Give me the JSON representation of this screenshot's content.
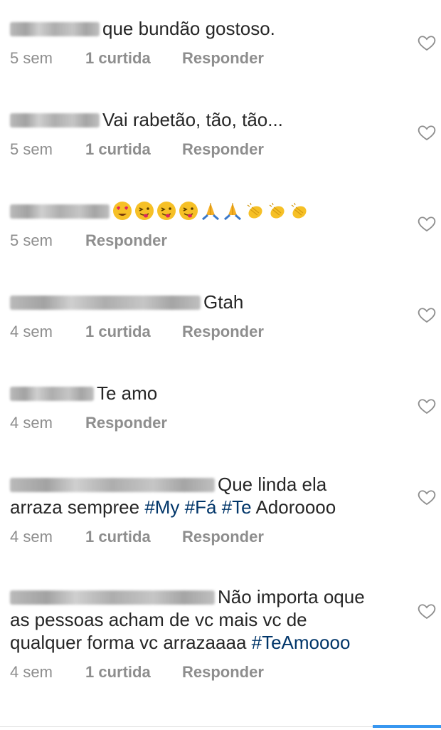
{
  "comments": [
    {
      "text": "que bundão gostoso.",
      "time": "5 sem",
      "likes": "1 curtida",
      "reply": "Responder"
    },
    {
      "text": "Vai rabetão, tão, tão...",
      "time": "5 sem",
      "likes": "1 curtida",
      "reply": "Responder"
    },
    {
      "text": "",
      "emojis": [
        "heart-eyes-emoji",
        "winking-tongue-emoji",
        "winking-tongue-emoji",
        "winking-tongue-emoji",
        "folded-hands-emoji",
        "folded-hands-emoji",
        "clapping-hands-emoji",
        "clapping-hands-emoji",
        "clapping-hands-emoji"
      ],
      "time": "5 sem",
      "reply": "Responder"
    },
    {
      "text": "Gtah",
      "time": "4 sem",
      "likes": "1 curtida",
      "reply": "Responder"
    },
    {
      "text": "Te amo",
      "time": "4 sem",
      "reply": "Responder"
    },
    {
      "text_before": "Que linda ela arraza sempree",
      "tags": [
        "#My",
        "#Fá",
        "#Te"
      ],
      "text_after": "Adoroooo",
      "time": "4 sem",
      "likes": "1 curtida",
      "reply": "Responder"
    },
    {
      "text_before": "Não importa oque as pessoas acham de vc mais vc de qualquer forma vc arrazaaaa",
      "tags": [
        "#TeAmoooo"
      ],
      "time": "4 sem",
      "likes": "1 curtida",
      "reply": "Responder"
    }
  ],
  "icons": {
    "like": "heart-outline-icon"
  },
  "colors": {
    "text": "#262626",
    "meta": "#8e8e8e",
    "hashtag": "#003569",
    "accent": "#3897f0"
  }
}
